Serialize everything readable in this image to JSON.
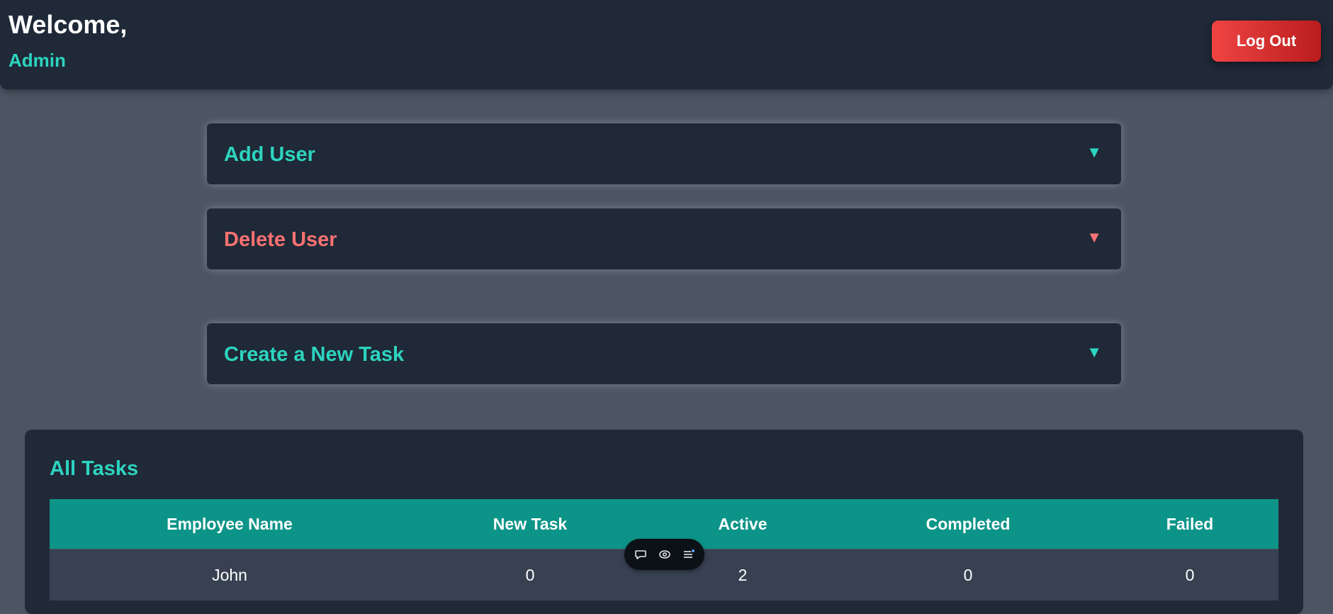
{
  "header": {
    "welcome": "Welcome,",
    "user_name": "Admin",
    "logout_label": "Log Out"
  },
  "panels": [
    {
      "title": "Add User",
      "color": "#2dd4bf",
      "arrow": "▼"
    },
    {
      "title": "Delete User",
      "color": "#f87171",
      "arrow": "▼"
    },
    {
      "title": "Create a New Task",
      "color": "#2dd4bf",
      "arrow": "▼"
    }
  ],
  "tasks": {
    "title": "All Tasks",
    "columns": [
      "Employee Name",
      "New Task",
      "Active",
      "Completed",
      "Failed"
    ],
    "rows": [
      [
        "John",
        "0",
        "2",
        "0",
        "0"
      ]
    ]
  },
  "toolbar": {
    "icons": [
      "chat-bubble-icon",
      "eye-icon",
      "list-icon"
    ]
  },
  "colors": {
    "background": "#4b5563",
    "surface": "#1f2937",
    "accent_teal": "#2dd4bf",
    "accent_red": "#f87171",
    "table_header": "#0d9488",
    "logout_gradient_start": "#ef4444",
    "logout_gradient_end": "#b91c1c"
  }
}
